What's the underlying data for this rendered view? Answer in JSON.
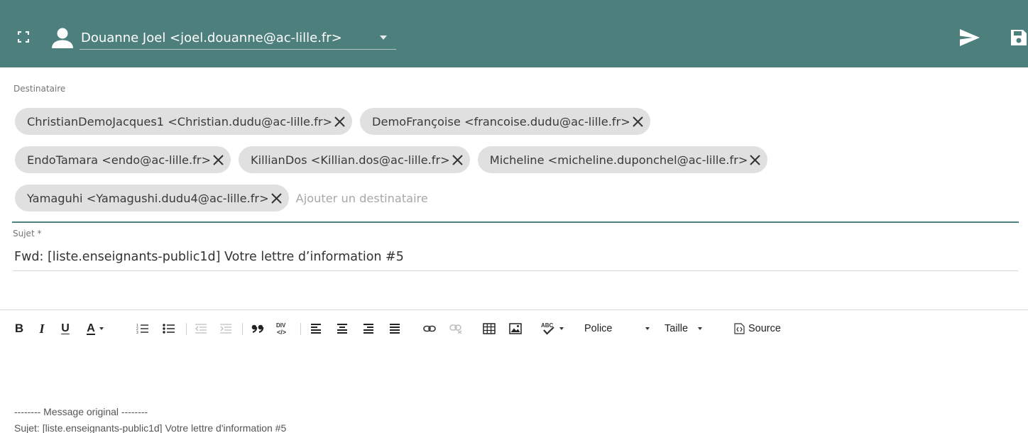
{
  "header": {
    "from_value": "Douanne Joel <joel.douanne@ac-lille.fr>",
    "background_color": "#4d7f7c",
    "icons": [
      "fullscreen-icon",
      "person-icon",
      "send-icon",
      "save-icon"
    ]
  },
  "recipients": {
    "label": "Destinataire",
    "placeholder": "Ajouter un destinataire",
    "rows": [
      [
        "ChristianDemoJacques1 <Christian.dudu@ac-lille.fr>",
        "DemoFrançoise <francoise.dudu@ac-lille.fr>"
      ],
      [
        "EndoTamara <endo@ac-lille.fr>",
        "KillianDos <Killian.dos@ac-lille.fr>",
        "Micheline <micheline.duponchel@ac-lille.fr>"
      ],
      [
        "Yamaguhi <Yamagushi.dudu4@ac-lille.fr>"
      ]
    ]
  },
  "subject": {
    "label": "Sujet *",
    "value": "Fwd: [liste.enseignants-public1d] Votre lettre d’information #5"
  },
  "toolbar": {
    "bold": "B",
    "italic": "I",
    "underline": "U",
    "text_color": "A",
    "font_label": "Police",
    "size_label": "Taille",
    "source_label": "Source",
    "icons": [
      "bold-icon",
      "italic-icon",
      "underline-icon",
      "text-color-icon",
      "numbered-list-icon",
      "bulleted-list-icon",
      "decrease-indent-icon",
      "increase-indent-icon",
      "blockquote-icon",
      "div-icon",
      "align-left-icon",
      "align-center-icon",
      "align-right-icon",
      "justify-icon",
      "link-icon",
      "unlink-icon",
      "table-icon",
      "image-icon",
      "spellcheck-icon",
      "source-icon"
    ]
  },
  "body": {
    "separator": "-------- Message original --------",
    "subject_line": "Sujet: [liste.enseignants-public1d] Votre lettre d'information #5"
  }
}
